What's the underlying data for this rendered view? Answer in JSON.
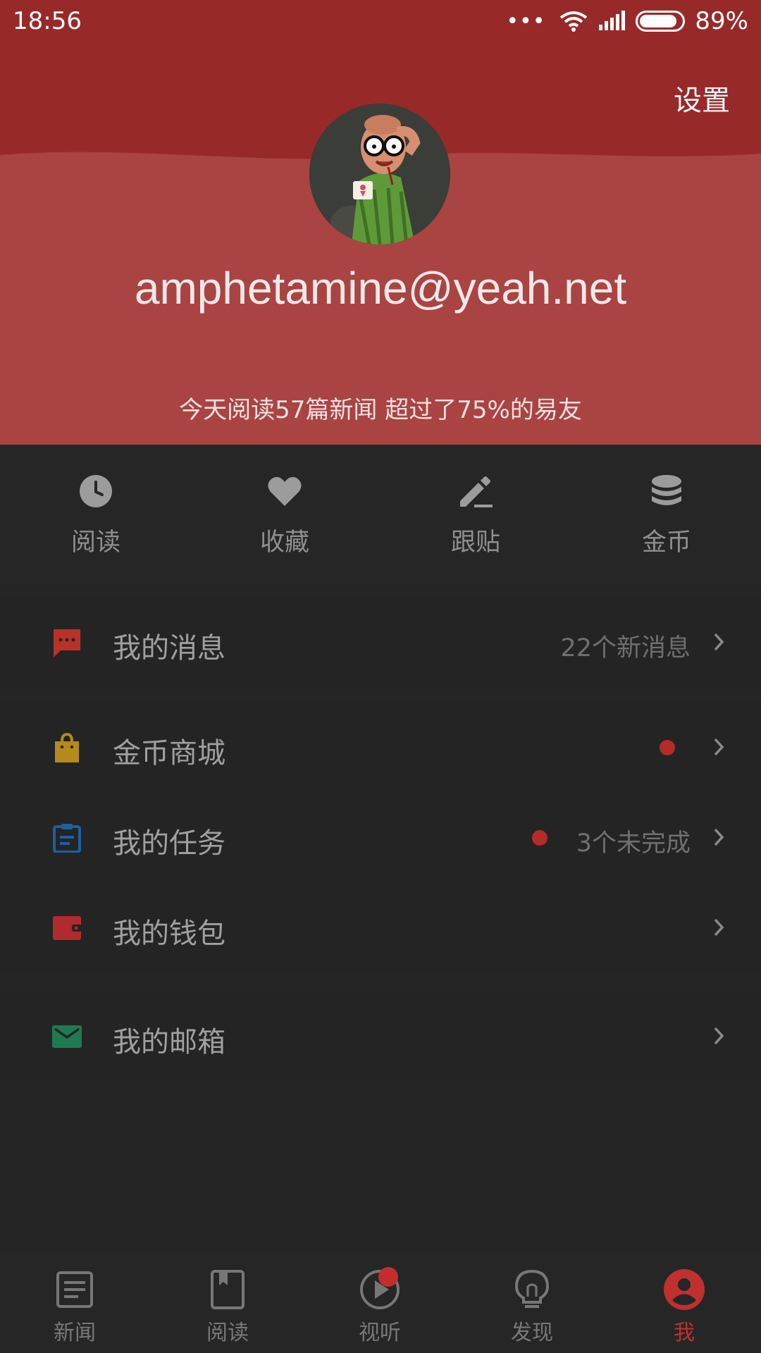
{
  "status_bar": {
    "time": "18:56",
    "dots": "•••",
    "battery": "89%"
  },
  "header": {
    "settings_label": "设置",
    "username": "amphetamine@yeah.net",
    "stats": "今天阅读57篇新闻 超过了75%的易友"
  },
  "quick_actions": [
    {
      "label": "阅读",
      "icon": "clock-icon"
    },
    {
      "label": "收藏",
      "icon": "heart-icon"
    },
    {
      "label": "跟贴",
      "icon": "pencil-icon"
    },
    {
      "label": "金币",
      "icon": "coins-icon"
    }
  ],
  "menu": {
    "messages": {
      "label": "我的消息",
      "extra": "22个新消息",
      "icon": "chat-icon",
      "color": "#b83229"
    },
    "coin_mall": {
      "label": "金币商城",
      "icon": "shopping-bag-icon",
      "color": "#b58a1a"
    },
    "tasks": {
      "label": "我的任务",
      "extra": "3个未完成",
      "icon": "clipboard-icon",
      "color": "#1f5fa0"
    },
    "wallet": {
      "label": "我的钱包",
      "icon": "wallet-icon",
      "color": "#b02a2e"
    },
    "mailbox": {
      "label": "我的邮箱",
      "icon": "mail-icon",
      "color": "#1f7a52"
    }
  },
  "bottom_nav": [
    {
      "label": "新闻",
      "icon": "news-icon"
    },
    {
      "label": "阅读",
      "icon": "bookmark-icon"
    },
    {
      "label": "视听",
      "icon": "play-icon"
    },
    {
      "label": "发现",
      "icon": "lightbulb-icon"
    },
    {
      "label": "我",
      "icon": "profile-icon"
    }
  ],
  "colors": {
    "header_top": "#982929",
    "header": "#a94443",
    "accent": "#c0302f",
    "background": "#252525"
  }
}
